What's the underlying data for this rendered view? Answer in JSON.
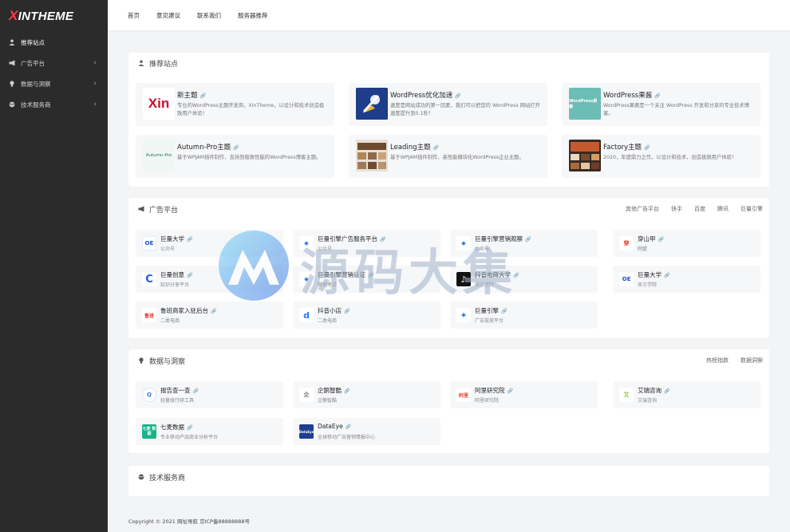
{
  "brand": {
    "x": "X",
    "rest": "INTHEME"
  },
  "sidebar": {
    "items": [
      {
        "label": "推荐站点",
        "icon": "user-icon",
        "active": true,
        "arrow": ""
      },
      {
        "label": "广告平台",
        "icon": "megaphone-icon",
        "arrow": "›"
      },
      {
        "label": "数据与洞察",
        "icon": "lightbulb-icon",
        "arrow": "›"
      },
      {
        "label": "技术服务商",
        "icon": "globe-icon",
        "arrow": "›"
      }
    ]
  },
  "topnav": [
    "首页",
    "意见建议",
    "联系我们",
    "服务器推荐"
  ],
  "sections": {
    "recommended": {
      "title": "推荐站点",
      "cards": [
        {
          "title": "新主题",
          "desc": "专业的WordPress主题开发商，XinTheme，以设计和技术创造极致用户体验！",
          "thumb_text": "Xin"
        },
        {
          "title": "WordPress优化加速",
          "desc": "速度是网站成功的第一因素，我们可以把您的 WordPress 网站打开速度提升到0.1秒！"
        },
        {
          "title": "WordPress果酱",
          "desc": "WordPress果酱是一个关注 WordPress 开发和分享的专业技术博客。",
          "thumb_text": "WordPress果酱"
        },
        {
          "title": "Autumn-Pro主题",
          "desc": "基于WPJAM插件制作，支持到极致性能的WordPress博客主题。",
          "thumb_text": "Autumn-Pro"
        },
        {
          "title": "Leading主题",
          "desc": "基于WPJAM插件制作、高性能模块化WordPress企业主题。"
        },
        {
          "title": "Factory主题",
          "desc": "2020，年度鼎力之作。以设计和技术，创造极致用户体验！"
        }
      ]
    },
    "ads": {
      "title": "广告平台",
      "links": [
        "其他广告平台",
        "快手",
        "百度",
        "腾讯",
        "巨量引擎"
      ],
      "cards": [
        {
          "title": "巨量大学",
          "desc": "公众号",
          "icon_text": "OE"
        },
        {
          "title": "巨量引擎广告服务平台",
          "desc": "公众号",
          "icon_text": "◆"
        },
        {
          "title": "巨量引擎营销观察",
          "desc": "公众号",
          "icon_text": "◆"
        },
        {
          "title": "穿山甲",
          "desc": "网盟",
          "icon_text": "穿"
        },
        {
          "title": "巨量创意",
          "desc": "知识分享平台",
          "icon_text": "C"
        },
        {
          "title": "巨量引擎营销认证",
          "desc": "营销考试",
          "icon_text": "◆"
        },
        {
          "title": "抖音电商大学",
          "desc": "官方学院",
          "icon_text": "♪"
        },
        {
          "title": "巨量大学",
          "desc": "官方学院",
          "icon_text": "OE"
        },
        {
          "title": "鲁班商家入驻后台",
          "desc": "二类电商",
          "icon_text": "鲁班"
        },
        {
          "title": "抖音小店",
          "desc": "二类电商",
          "icon_text": "d"
        },
        {
          "title": "巨量引擎",
          "desc": "广告投放平台",
          "icon_text": "✦"
        }
      ]
    },
    "data": {
      "title": "数据与洞察",
      "links": [
        "热榜指数",
        "数据洞察"
      ],
      "cards": [
        {
          "title": "报告查一查",
          "desc": "轻量级行研工具",
          "icon_text": "Q"
        },
        {
          "title": "企鹅智酷",
          "desc": "企鹅智酷",
          "icon_text": "企"
        },
        {
          "title": "阿里研究院",
          "desc": "阿里研究院",
          "icon_text": "阿里"
        },
        {
          "title": "艾瑞咨询",
          "desc": "艾瑞咨询",
          "icon_text": "艾"
        },
        {
          "title": "七麦数据",
          "desc": "专业移动产品商业分析平台",
          "icon_text": "七麦 数据"
        },
        {
          "title": "DataEye",
          "desc": "全球移动广告营销情报中心",
          "icon_text": "DataEye"
        }
      ]
    },
    "tech": {
      "title": "技术服务商"
    }
  },
  "footer": "Copyright © 2021 网址导航 京ICP备88888888号",
  "watermark": "源码大集",
  "colors": {
    "sidebar": "#2b2b2b",
    "brand_red": "#ff3a44",
    "page_bg": "#f3f4f6",
    "card_bg": "#f6f7f9"
  }
}
